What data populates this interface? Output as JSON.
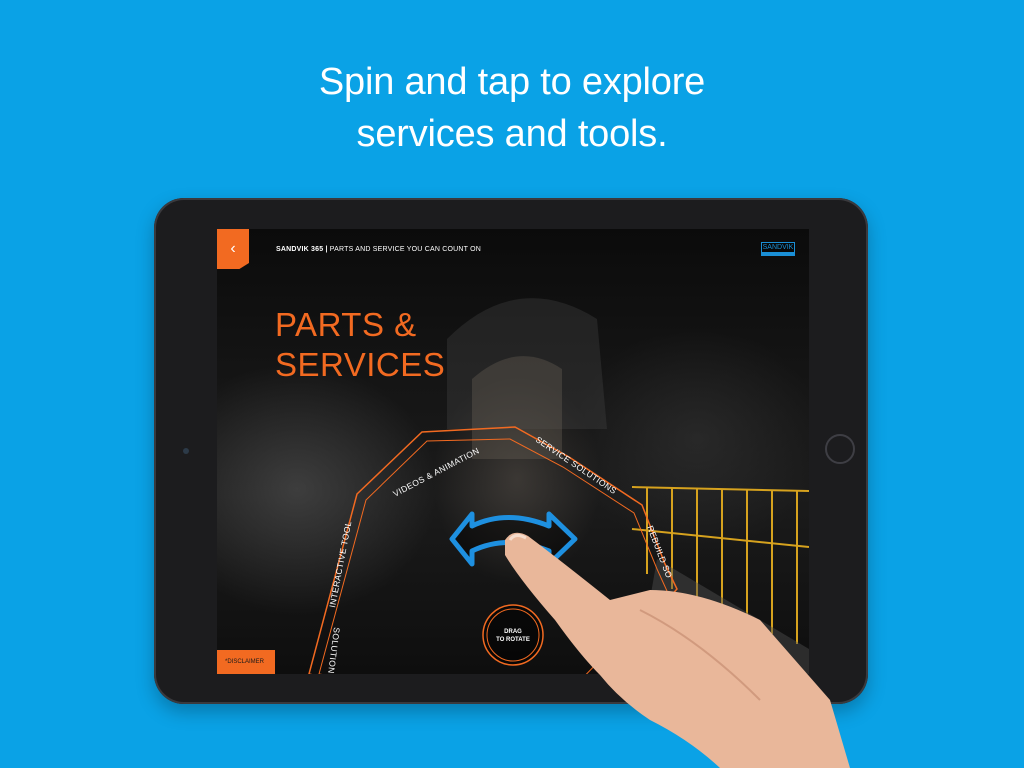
{
  "headline": {
    "line1": "Spin and tap to explore",
    "line2": "services and tools."
  },
  "app": {
    "back_icon": "chevron-left-icon",
    "header_brand": "SANDVIK 365 |",
    "header_tagline": " PARTS AND SERVICE YOU CAN COUNT ON",
    "logo_text": "SANDVIK",
    "title_line1": "PARTS &",
    "title_line2": "SERVICES",
    "disclaimer": "*DISCLAIMER"
  },
  "dial": {
    "segments": [
      "INTERACTIVE TOOLS",
      "VIDEOS & ANIMATIONS",
      "SERVICE SOLUTIONS",
      "REBUILD SO",
      "SOLUTIONS"
    ],
    "center_line1": "DRAG",
    "center_line2": "TO ROTATE"
  },
  "colors": {
    "background": "#0AA2E6",
    "accent": "#F26A21",
    "brand_blue": "#1a8fd6",
    "arrow_blue": "#1e90e0"
  }
}
